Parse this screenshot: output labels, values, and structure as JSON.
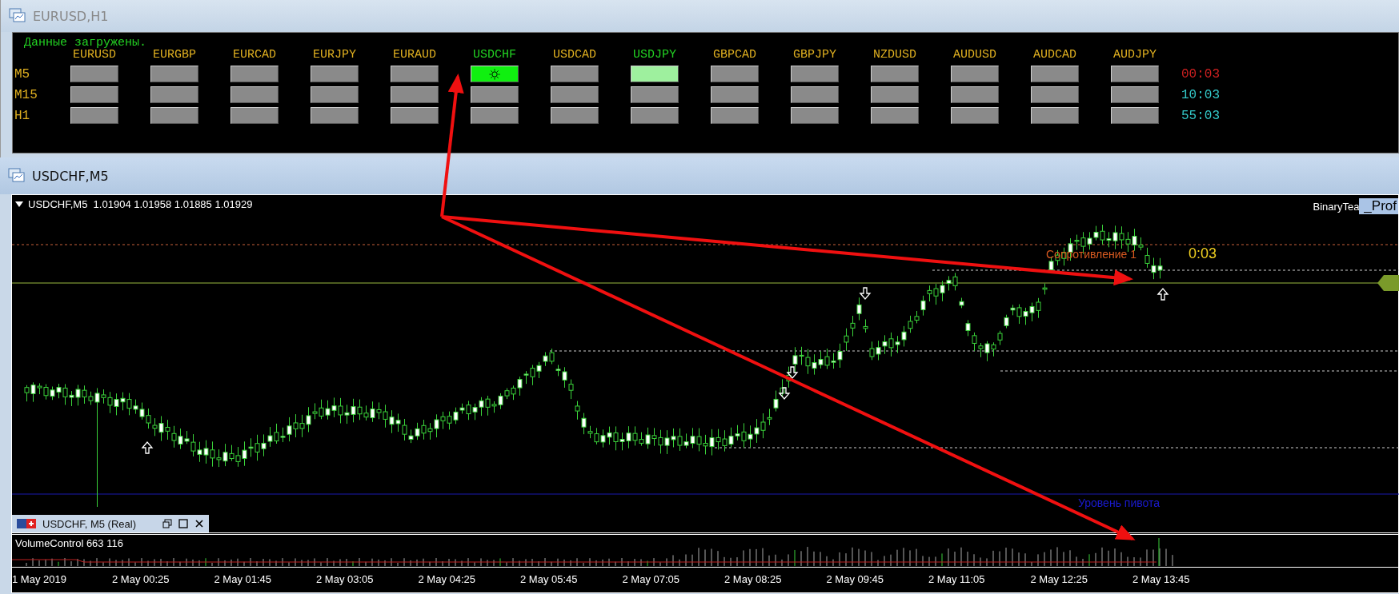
{
  "window_top": {
    "title": "EURUSD,H1"
  },
  "scanner": {
    "status": "Данные загружены.",
    "symbols": [
      {
        "label": "EURUSD",
        "active": false
      },
      {
        "label": "EURGBP",
        "active": false
      },
      {
        "label": "EURCAD",
        "active": false
      },
      {
        "label": "EURJPY",
        "active": false
      },
      {
        "label": "EURAUD",
        "active": false
      },
      {
        "label": "USDCHF",
        "active": true
      },
      {
        "label": "USDCAD",
        "active": false
      },
      {
        "label": "USDJPY",
        "active": true
      },
      {
        "label": "GBPCAD",
        "active": false
      },
      {
        "label": "GBPJPY",
        "active": false
      },
      {
        "label": "NZDUSD",
        "active": false
      },
      {
        "label": "AUDUSD",
        "active": false
      },
      {
        "label": "AUDCAD",
        "active": false
      },
      {
        "label": "AUDJPY",
        "active": false
      }
    ],
    "rows": [
      {
        "label": "M5",
        "timer": "00:03",
        "color": "#cc2020",
        "cells": [
          {
            "lit": false,
            "signal": false
          },
          {
            "lit": false,
            "signal": false
          },
          {
            "lit": false,
            "signal": false
          },
          {
            "lit": false,
            "signal": false
          },
          {
            "lit": false,
            "signal": false
          },
          {
            "lit": true,
            "signal": true
          },
          {
            "lit": false,
            "signal": false
          },
          {
            "lit": true,
            "signal": false
          },
          {
            "lit": false,
            "signal": false
          },
          {
            "lit": false,
            "signal": false
          },
          {
            "lit": false,
            "signal": false
          },
          {
            "lit": false,
            "signal": false
          },
          {
            "lit": false,
            "signal": false
          },
          {
            "lit": false,
            "signal": false
          }
        ]
      },
      {
        "label": "M15",
        "timer": "10:03",
        "color": "#33c8c8",
        "cells": [
          {
            "lit": false,
            "signal": false
          },
          {
            "lit": false,
            "signal": false
          },
          {
            "lit": false,
            "signal": false
          },
          {
            "lit": false,
            "signal": false
          },
          {
            "lit": false,
            "signal": false
          },
          {
            "lit": false,
            "signal": false
          },
          {
            "lit": false,
            "signal": false
          },
          {
            "lit": false,
            "signal": false
          },
          {
            "lit": false,
            "signal": false
          },
          {
            "lit": false,
            "signal": false
          },
          {
            "lit": false,
            "signal": false
          },
          {
            "lit": false,
            "signal": false
          },
          {
            "lit": false,
            "signal": false
          },
          {
            "lit": false,
            "signal": false
          }
        ]
      },
      {
        "label": "H1",
        "timer": "55:03",
        "color": "#33c8c8",
        "cells": [
          {
            "lit": false,
            "signal": false
          },
          {
            "lit": false,
            "signal": false
          },
          {
            "lit": false,
            "signal": false
          },
          {
            "lit": false,
            "signal": false
          },
          {
            "lit": false,
            "signal": false
          },
          {
            "lit": false,
            "signal": false
          },
          {
            "lit": false,
            "signal": false
          },
          {
            "lit": false,
            "signal": false
          },
          {
            "lit": false,
            "signal": false
          },
          {
            "lit": false,
            "signal": false
          },
          {
            "lit": false,
            "signal": false
          },
          {
            "lit": false,
            "signal": false
          },
          {
            "lit": false,
            "signal": false
          },
          {
            "lit": false,
            "signal": false
          }
        ]
      }
    ]
  },
  "window_chart": {
    "title": "USDCHF,M5"
  },
  "chart": {
    "header": "USDCHF,M5  1.01904 1.01958 1.01885 1.01929",
    "indicator_label": "BinaryTea",
    "panel_tag": "_Prof",
    "resistance_label": "Сопротивление 1",
    "countdown": "0:03",
    "pivot_label": "Уровень пивота",
    "tab_label": "USDCHF, M5 (Real)",
    "volume_label": "VolumeControl 663 116",
    "time_labels": [
      "1 May 2019",
      "2 May 00:25",
      "2 May 01:45",
      "2 May 03:05",
      "2 May 04:25",
      "2 May 05:45",
      "2 May 07:05",
      "2 May 08:25",
      "2 May 09:45",
      "2 May 11:05",
      "2 May 12:25",
      "2 May 13:45"
    ]
  }
}
